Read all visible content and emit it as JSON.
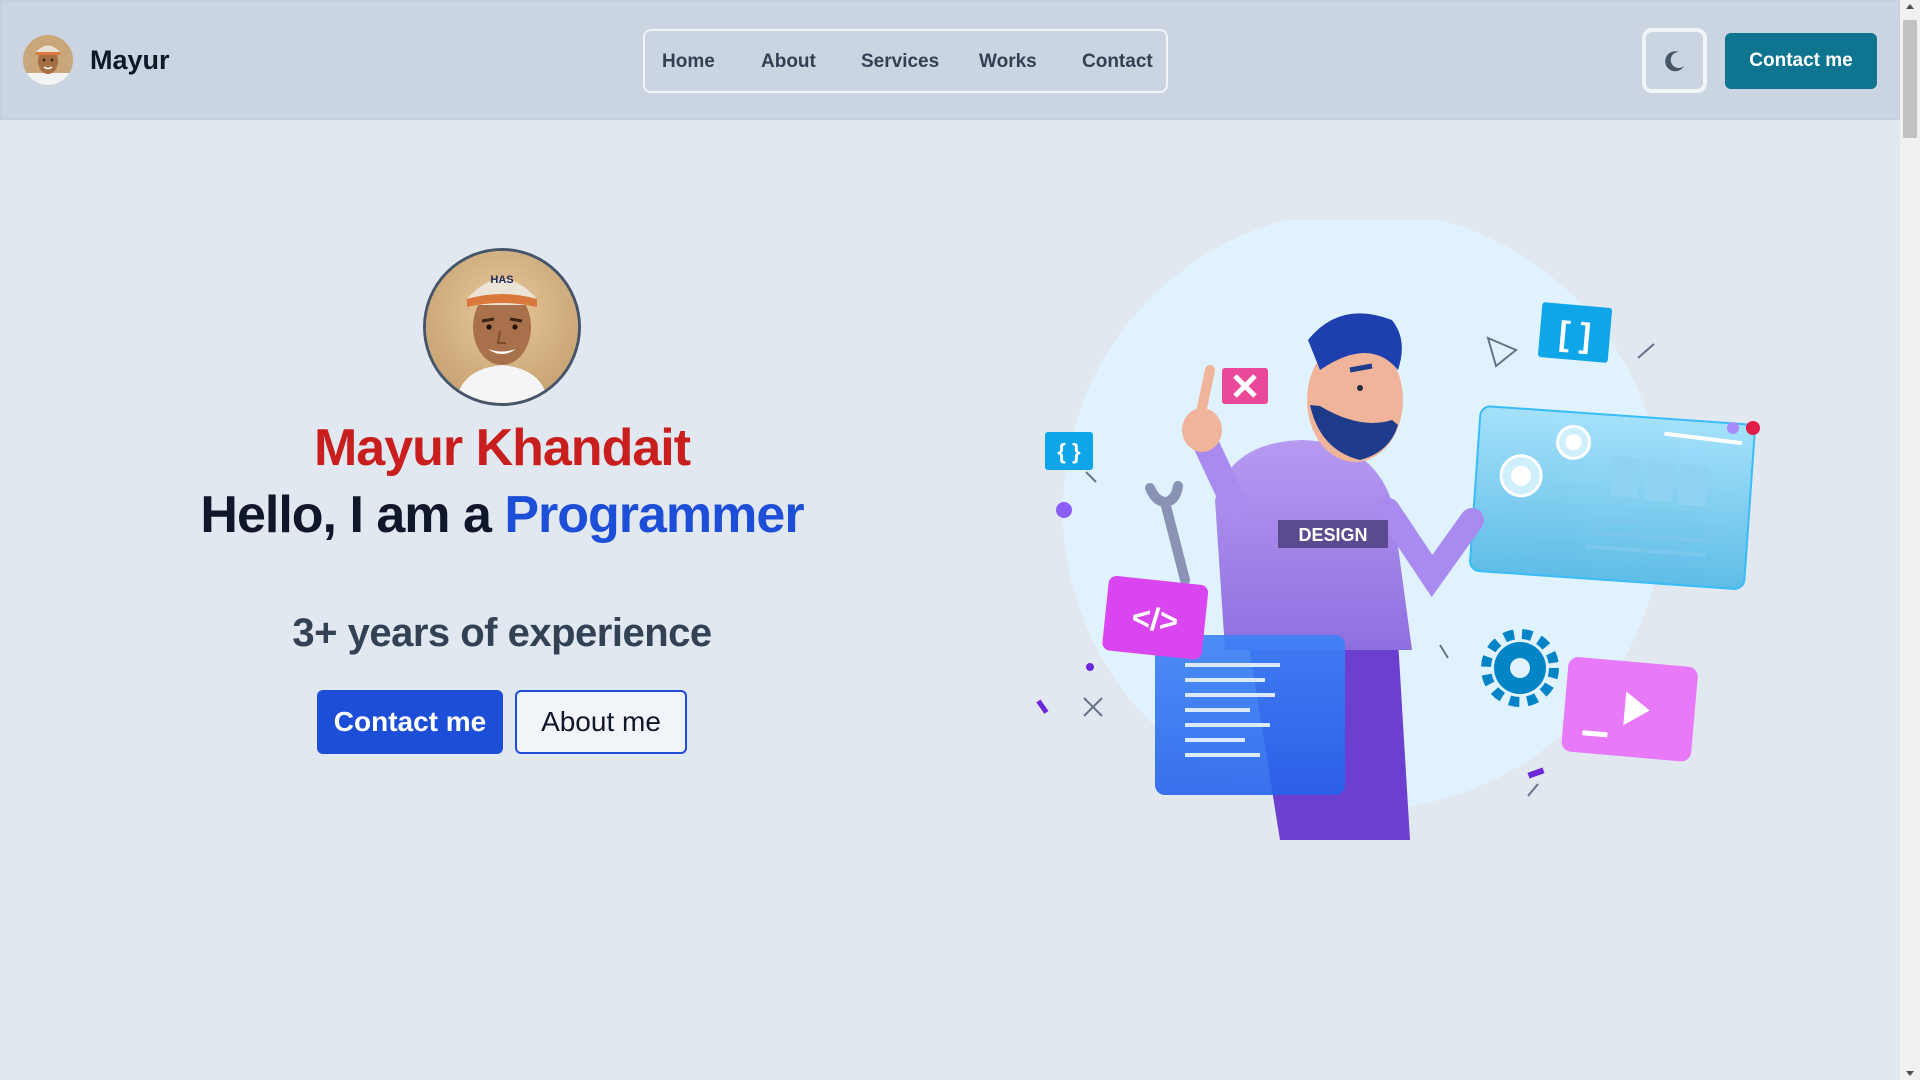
{
  "brand": {
    "name": "Mayur"
  },
  "nav": {
    "links": [
      "Home",
      "About",
      "Services",
      "Works",
      "Contact"
    ],
    "cta_label": "Contact me"
  },
  "hero": {
    "name": "Mayur Khandait",
    "greeting_prefix": "Hello, I am a",
    "role": "Programmer",
    "experience": "3+ years of experience",
    "primary_button": "Contact me",
    "secondary_button": "About me"
  },
  "illustration": {
    "badge_text": "DESIGN"
  },
  "colors": {
    "accent_red": "#c81e1e",
    "accent_blue": "#1d4ed8",
    "nav_cta_teal": "#0e7490",
    "navbar_bg": "#cbd5e1",
    "page_bg": "#e2e8f0"
  },
  "icons": {
    "theme_toggle": "moon-icon"
  }
}
